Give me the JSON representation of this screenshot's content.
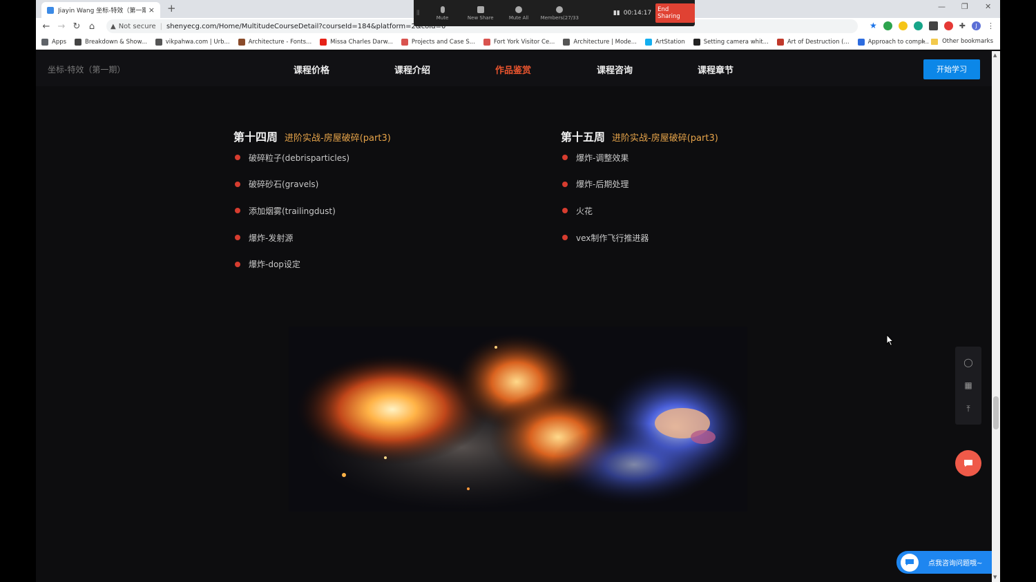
{
  "browser": {
    "tab_title": "Jiayin Wang 坐标-特效（第一期",
    "tab_close": "×",
    "new_tab": "+",
    "window_controls": [
      "—",
      "❐",
      "✕"
    ],
    "security": "Not secure",
    "url": "shenyecg.com/Home/MultitudeCourseDetail?courseId=184&platform=2&coId=0",
    "bookmarks": [
      {
        "label": "Apps",
        "color": "#5f6368"
      },
      {
        "label": "Breakdown & Show...",
        "color": "#444"
      },
      {
        "label": "vikpahwa.com | Urb...",
        "color": "#555"
      },
      {
        "label": "Architecture - Fonts...",
        "color": "#8a4b2a"
      },
      {
        "label": "Missa Charles Darw...",
        "color": "#e62117"
      },
      {
        "label": "Projects and Case S...",
        "color": "#d9534f"
      },
      {
        "label": "Fort York Visitor Ce...",
        "color": "#d9534f"
      },
      {
        "label": "Architecture | Mode...",
        "color": "#555"
      },
      {
        "label": "ArtStation",
        "color": "#13aff0"
      },
      {
        "label": "Setting camera whit...",
        "color": "#222"
      },
      {
        "label": "Art of Destruction (...",
        "color": "#c0392b"
      },
      {
        "label": "Approach to compl...",
        "color": "#2d6cdf"
      }
    ],
    "bookmarks_more": "»",
    "other_bookmarks": "Other bookmarks",
    "profile_initial": "J"
  },
  "sharebar": {
    "items": [
      "Mute",
      "New Share",
      "Mute All",
      "Members(27/33"
    ],
    "timer": "00:14:17",
    "end_label": "End Sharing"
  },
  "site": {
    "brand": "坐标-特效（第一期）",
    "nav": [
      "课程价格",
      "课程介绍",
      "作品鉴赏",
      "课程咨询",
      "课程章节"
    ],
    "start_button": "开始学习"
  },
  "weeks": [
    {
      "title": "第十四周",
      "topic": "进阶实战-房屋破碎(part3)",
      "lessons": [
        "破碎粒子(debrisparticles)",
        "破碎砂石(gravels)",
        "添加烟雾(trailingdust)",
        "爆炸-发射源",
        "爆炸-dop设定"
      ]
    },
    {
      "title": "第十五周",
      "topic": "进阶实战-房屋破碎(part3)",
      "lessons": [
        "爆炸-调整效果",
        "爆炸-后期处理",
        "火花",
        "vex制作飞行推进器"
      ]
    }
  ],
  "chat": {
    "label": "点我咨询问题哦~"
  },
  "colors": {
    "accent_nav": "#e8542e",
    "topic": "#e8a54a",
    "bullet": "#d63c2f",
    "primary_button": "#0c87e8",
    "chat_bar": "#1e86f0",
    "chat_circle": "#ef5a49"
  }
}
